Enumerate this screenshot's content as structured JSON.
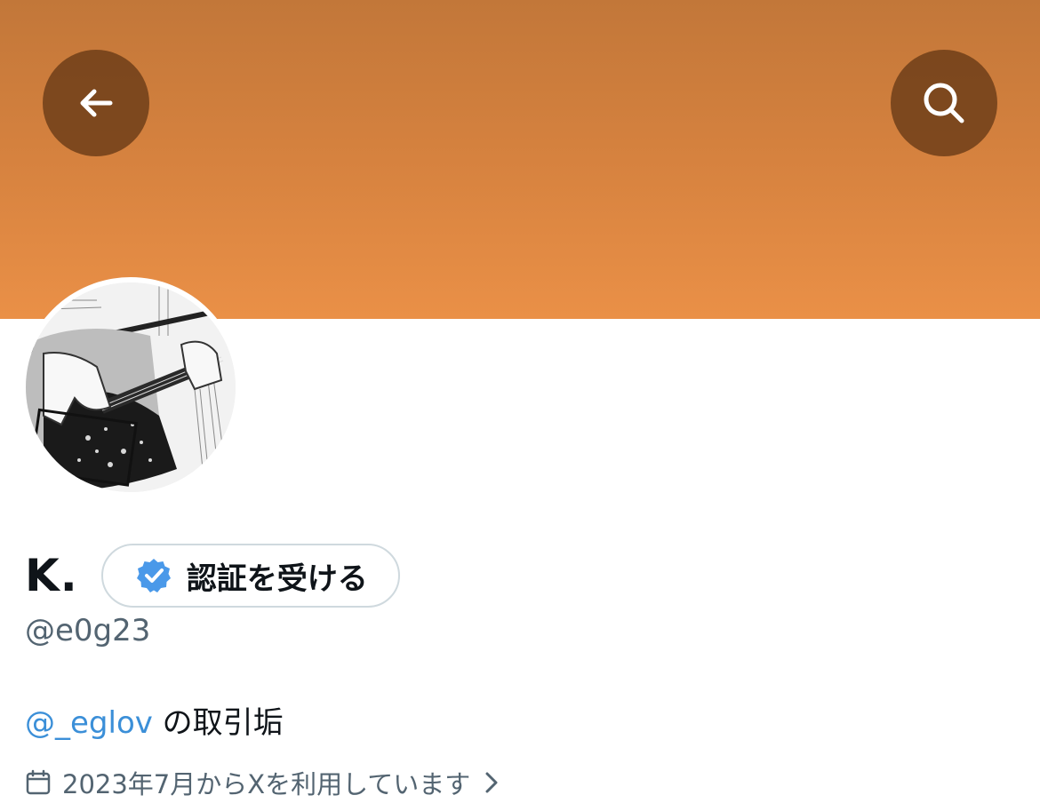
{
  "header": {
    "banner_color_top": "#c27739",
    "banner_color_bottom": "#ea9047",
    "back_icon": "arrow-left-icon",
    "search_icon": "search-icon"
  },
  "profile": {
    "display_name": "K.",
    "verify_button_label": "認証を受ける",
    "verify_icon": "verified-badge-icon",
    "verify_icon_color": "#4a99e9",
    "handle": "@e0g23",
    "bio_mention": "@_eglov",
    "bio_text": " の取引垢",
    "joined_text": "2023年7月からXを利用しています",
    "joined_icon": "calendar-icon",
    "link_color": "#3b8fd8"
  }
}
